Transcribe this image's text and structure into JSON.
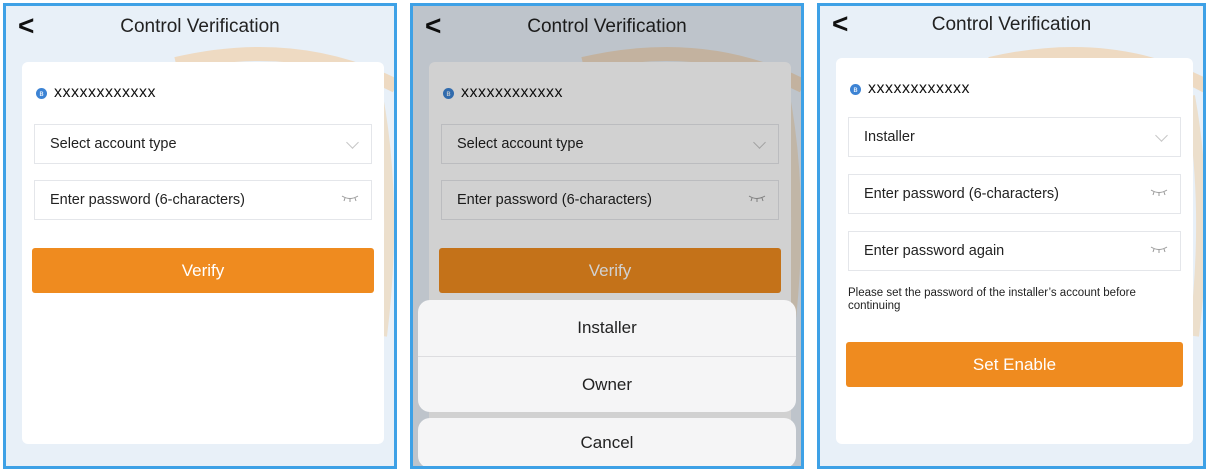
{
  "screens": [
    {
      "title": "Control Verification",
      "device_id": "xxxxxxxxxxxx",
      "account_type_placeholder": "Select account type",
      "password_placeholder": "Enter password (6-characters)",
      "verify_label": "Verify"
    },
    {
      "title": "Control Verification",
      "device_id": "xxxxxxxxxxxx",
      "account_type_placeholder": "Select account type",
      "password_placeholder": "Enter password (6-characters)",
      "verify_label": "Verify",
      "action_sheet": {
        "options": [
          "Installer",
          "Owner"
        ],
        "cancel_label": "Cancel"
      }
    },
    {
      "title": "Control Verification",
      "device_id": "xxxxxxxxxxxx",
      "account_type_value": "Installer",
      "password_placeholder": "Enter password (6-characters)",
      "password_again_placeholder": "Enter password again",
      "note": "Please set the password of the installer’s account before continuing",
      "set_enable_label": "Set Enable"
    }
  ],
  "icons": {
    "back": "back-chevron-icon",
    "bluetooth": "bluetooth-icon",
    "dropdown": "chevron-down-icon",
    "password_visibility": "closed-eye-icon"
  },
  "colors": {
    "accent": "#ef8b1f",
    "frame": "#3ea1e6",
    "background": "#e8f0f8"
  }
}
